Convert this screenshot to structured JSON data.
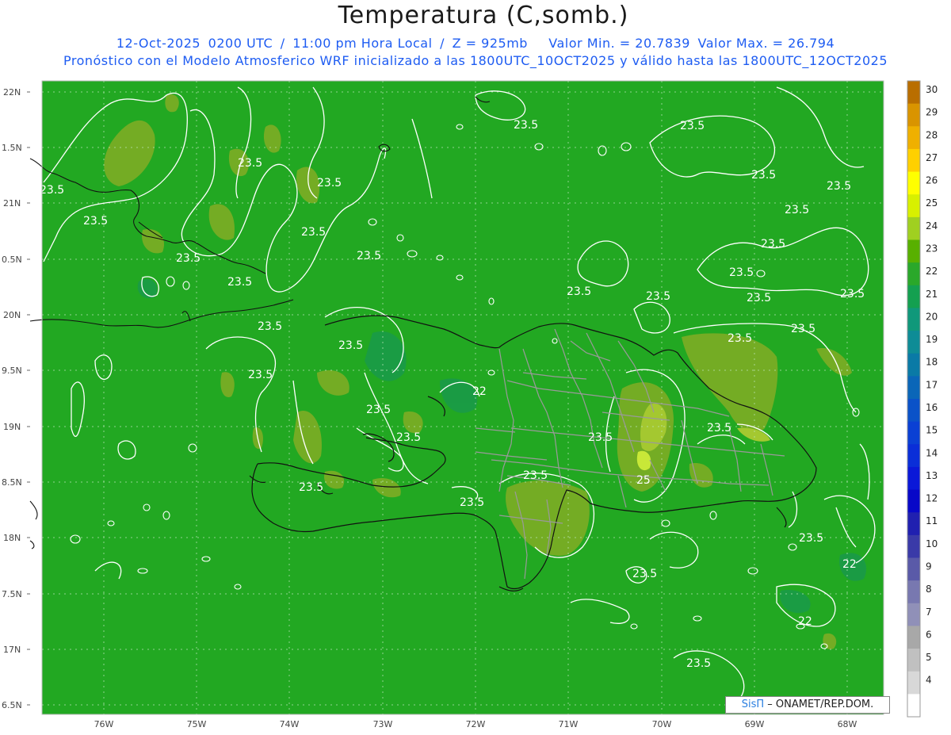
{
  "title": "Temperatura (C,somb.)",
  "subtitle": {
    "date": "12-Oct-2025",
    "time_utc": "0200 UTC",
    "local_time": "11:00 pm Hora Local",
    "level": "Z = 925mb",
    "min_label": "Valor Min. = 20.7839",
    "max_label": "Valor Max. = 26.794",
    "line2": "Pronóstico con el Modelo Atmosferico WRF inicializado a las 1800UTC_10OCT2025 y válido hasta las  1800UTC_12OCT2025"
  },
  "map": {
    "latitude_labels": [
      "22N",
      "1.5N",
      "21N",
      "0.5N",
      "20N",
      "9.5N",
      "19N",
      "8.5N",
      "18N",
      "7.5N",
      "17N",
      "6.5N"
    ],
    "longitude_labels": [
      "76W",
      "75W",
      "74W",
      "73W",
      "72W",
      "71W",
      "70W",
      "69W",
      "68W"
    ],
    "contour_labels": [
      "23.5",
      "22",
      "25"
    ]
  },
  "colorbar": {
    "values": [
      "30",
      "29",
      "28",
      "27",
      "26",
      "25",
      "24",
      "23",
      "22",
      "21",
      "20",
      "19",
      "18",
      "17",
      "16",
      "15",
      "14",
      "13",
      "12",
      "11",
      "10",
      "9",
      "8",
      "7",
      "6",
      "5",
      "4"
    ],
    "colors": [
      "#b96e00",
      "#d99400",
      "#efb000",
      "#ffd000",
      "#ffff00",
      "#d8f000",
      "#a0d020",
      "#58b000",
      "#2aa82a",
      "#14a050",
      "#10987a",
      "#0e8c96",
      "#0a7aa6",
      "#0a66b8",
      "#0a52c8",
      "#0a40d4",
      "#0a2ed8",
      "#0a18d8",
      "#0808c8",
      "#2020b0",
      "#3a3aa8",
      "#5a5aa8",
      "#7878b0",
      "#9090b8",
      "#a8a8a8",
      "#c0c0c0",
      "#d8d8d8",
      "#ffffff"
    ]
  },
  "credit": {
    "logo": "SisΠ",
    "text": "– ONAMET/REP.DOM."
  },
  "colors": {
    "field": "#22a822",
    "warm_patch": "#74ac24",
    "warmer_patch": "#a4c830",
    "hot_patch": "#c8e838",
    "cool_patch": "#1a9a48",
    "subtitle": "#1e5cf2"
  }
}
